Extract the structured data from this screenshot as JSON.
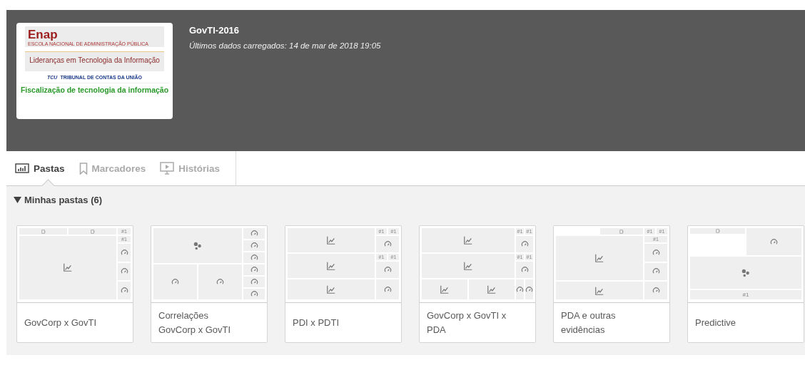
{
  "app": {
    "title": "GovTI-2016",
    "subtitle": "Últimos dados carregados: 14 de mar de 2018 19:05",
    "cover": {
      "brand": "Enap",
      "brand_caption": "ESCOLA NACIONAL DE ADMINISTRAÇÃO PÚBLICA",
      "heading": "Lideranças em Tecnologia da Informação",
      "org_mark": "TCU",
      "org_name": "TRIBUNAL DE CONTAS DA UNIÃO",
      "footer": "Fiscalização de tecnologia da informação"
    }
  },
  "tabs": [
    {
      "label": "Pastas",
      "kind": "sheets",
      "selected": true
    },
    {
      "label": "Marcadores",
      "kind": "bookmarks",
      "selected": false
    },
    {
      "label": "Histórias",
      "kind": "stories",
      "selected": false
    }
  ],
  "section": {
    "title": "Minhas pastas (6)",
    "expanded": true
  },
  "sheets": [
    {
      "title": "GovCorp x GovTI",
      "cells": [
        {
          "kind": "filter"
        },
        {
          "kind": "filter"
        },
        {
          "kind": "kpi",
          "label": "#1"
        },
        {
          "kind": "kpi",
          "label": "#1"
        },
        {
          "kind": "chart"
        },
        {
          "kind": "gauge"
        },
        {
          "kind": "gauge"
        },
        {
          "kind": "gauge"
        }
      ]
    },
    {
      "title": "Correlações GovCorp x GovTI",
      "cells": [
        {
          "kind": "scatter"
        },
        {
          "kind": "gauge"
        },
        {
          "kind": "gauge"
        },
        {
          "kind": "gauge"
        },
        {
          "kind": "gauge"
        },
        {
          "kind": "gauge"
        },
        {
          "kind": "gauge"
        },
        {
          "kind": "gauge"
        },
        {
          "kind": "gauge"
        }
      ]
    },
    {
      "title": "PDI x PDTI",
      "cells": [
        {
          "kind": "chart"
        },
        {
          "kind": "kpi",
          "label": "#1"
        },
        {
          "kind": "kpi",
          "label": "#1"
        },
        {
          "kind": "gauge"
        },
        {
          "kind": "chart"
        },
        {
          "kind": "kpi",
          "label": "#1"
        },
        {
          "kind": "kpi",
          "label": "#1"
        },
        {
          "kind": "gauge"
        },
        {
          "kind": "chart"
        },
        {
          "kind": "gauge"
        }
      ]
    },
    {
      "title": "GovCorp x GovTI x PDA",
      "cells": [
        {
          "kind": "chart"
        },
        {
          "kind": "kpi",
          "label": "#1"
        },
        {
          "kind": "kpi",
          "label": "#1"
        },
        {
          "kind": "gauge"
        },
        {
          "kind": "chart"
        },
        {
          "kind": "kpi",
          "label": "#1"
        },
        {
          "kind": "kpi",
          "label": "#1"
        },
        {
          "kind": "gauge"
        },
        {
          "kind": "chart"
        },
        {
          "kind": "chart"
        },
        {
          "kind": "gauge"
        },
        {
          "kind": "gauge"
        }
      ]
    },
    {
      "title": "PDA e outras evidências",
      "cells": [
        {
          "kind": "filter"
        },
        {
          "kind": "kpi",
          "label": "#1"
        },
        {
          "kind": "kpi",
          "label": "#1"
        },
        {
          "kind": "kpi",
          "label": "#1"
        },
        {
          "kind": "chart"
        },
        {
          "kind": "gauge"
        },
        {
          "kind": "gauge"
        },
        {
          "kind": "chart"
        },
        {
          "kind": "gauge"
        }
      ]
    },
    {
      "title": "Predictive",
      "cells": [
        {
          "kind": "filter"
        },
        {
          "kind": "gauge"
        },
        {
          "kind": "scatter"
        },
        {
          "kind": "kpi",
          "label": "#1"
        }
      ]
    }
  ]
}
